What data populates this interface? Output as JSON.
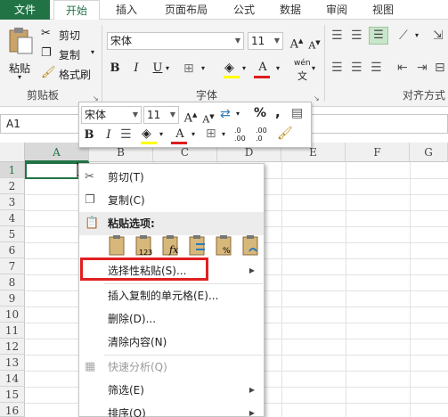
{
  "tabs": [
    {
      "label": "文件"
    },
    {
      "label": "开始"
    },
    {
      "label": "插入"
    },
    {
      "label": "页面布局"
    },
    {
      "label": "公式"
    },
    {
      "label": "数据"
    },
    {
      "label": "审阅"
    },
    {
      "label": "视图"
    }
  ],
  "ribbon": {
    "clipboard": {
      "paste": "粘贴",
      "cut": "剪切",
      "copy": "复制",
      "format_painter": "格式刷",
      "group_label": "剪贴板"
    },
    "font": {
      "font_name": "宋体",
      "font_size": "11",
      "bold": "B",
      "italic": "I",
      "underline": "U",
      "group_label": "字体",
      "wen_label": "wén",
      "font_color": "#e01b1b",
      "highlight_color": "#ffff00"
    },
    "alignment": {
      "group_label": "对齐方式"
    }
  },
  "namebox": {
    "value": "A1"
  },
  "columns": [
    "A",
    "B",
    "C",
    "D",
    "E",
    "F",
    "G"
  ],
  "rows": [
    "1",
    "2",
    "3",
    "4",
    "5",
    "6",
    "7",
    "8",
    "9",
    "10",
    "11",
    "12",
    "13",
    "14",
    "15",
    "16"
  ],
  "mini_toolbar": {
    "font_name": "宋体",
    "font_size": "11",
    "percent": "%",
    "comma": ",",
    "bold": "B",
    "italic": "I",
    "dec_inc": ".0\n.00",
    "dec_dec": ".00\n.0"
  },
  "context_menu": {
    "cut": "剪切(T)",
    "copy": "复制(C)",
    "paste_options": "粘贴选项:",
    "paste_special": "选择性粘贴(S)...",
    "insert_copied": "插入复制的单元格(E)...",
    "delete": "删除(D)...",
    "clear": "清除内容(N)",
    "quick_analysis": "快速分析(Q)",
    "filter": "筛选(E)",
    "sort": "排序(O)"
  },
  "colors": {
    "accent": "#217346",
    "highlight_box": "#e02020"
  }
}
